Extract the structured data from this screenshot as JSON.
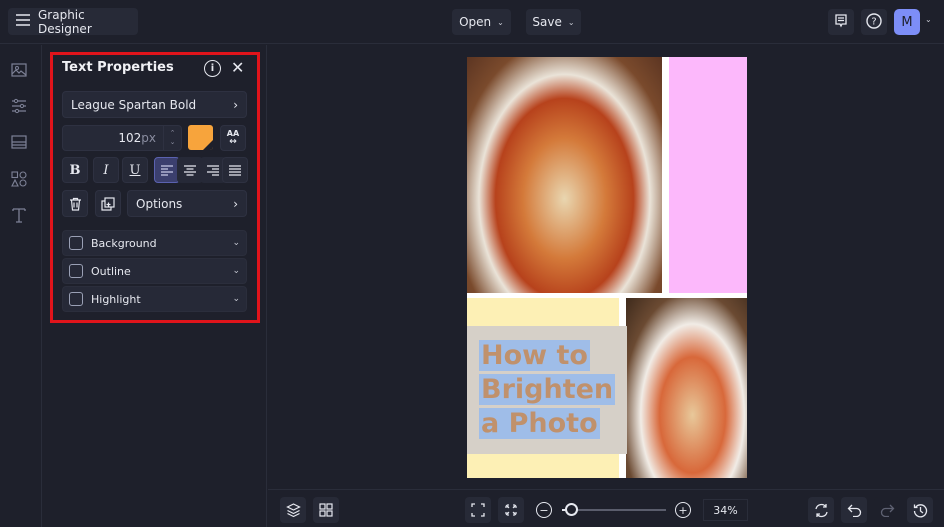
{
  "header": {
    "app_title": "Graphic Designer",
    "open_label": "Open",
    "save_label": "Save",
    "avatar_initial": "M"
  },
  "text_properties": {
    "title": "Text Properties",
    "font_name": "League Spartan Bold",
    "font_size_value": "102",
    "font_size_unit": "px",
    "text_color": "#f7a43c",
    "case_label": "AA",
    "bold_label": "B",
    "italic_label": "I",
    "underline_label": "U",
    "alignment_selected": "left",
    "options_label": "Options",
    "toggles": [
      {
        "label": "Background",
        "checked": false
      },
      {
        "label": "Outline",
        "checked": false
      },
      {
        "label": "Highlight",
        "checked": false
      }
    ]
  },
  "canvas": {
    "headline_lines": [
      "How to",
      "Brighten",
      "a Photo"
    ],
    "colors": {
      "pink": "#fcb8fb",
      "yellow": "#fdf0b5",
      "highlight": "#9fbde8",
      "text": "#c0916c"
    }
  },
  "bottombar": {
    "zoom_value": "34%",
    "zoom_fraction": 0.34
  },
  "accent": {
    "selection_border": "#e0141b",
    "avatar": "#7d8ef7"
  }
}
